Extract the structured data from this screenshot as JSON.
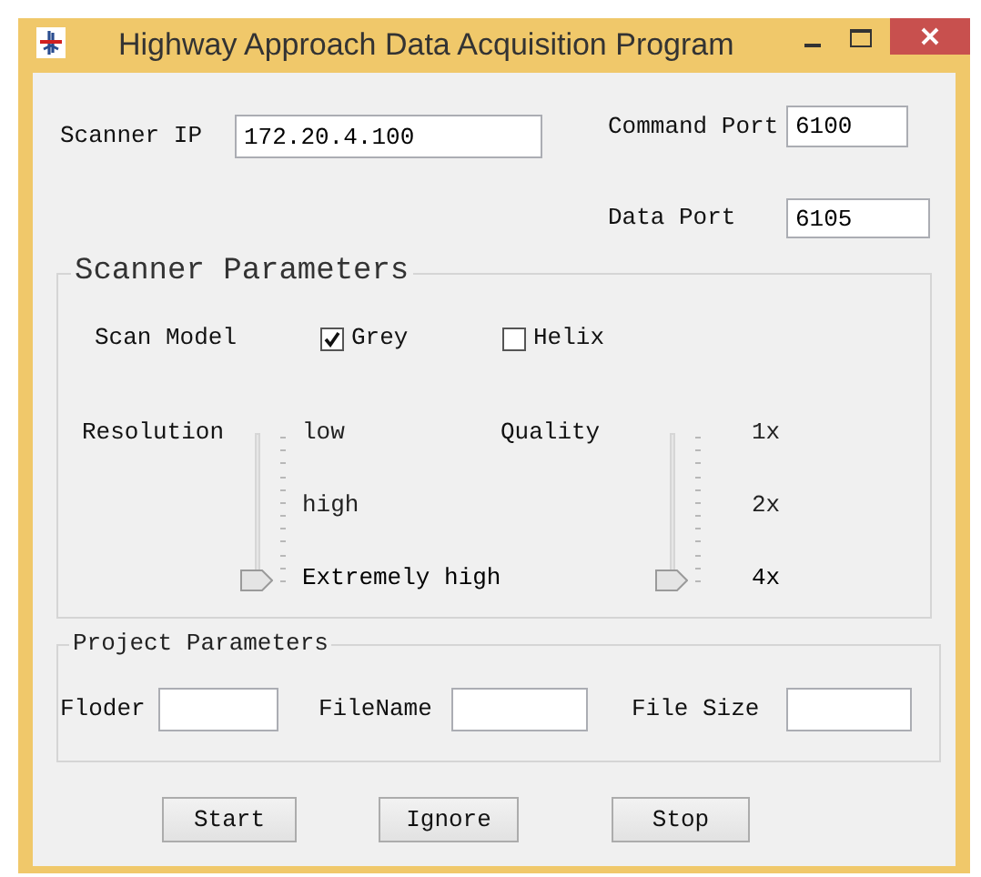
{
  "window": {
    "title": "Highway Approach Data Acquisition Program"
  },
  "connection": {
    "scanner_ip": {
      "label": "Scanner IP",
      "value": "172.20.4.100"
    },
    "command_port": {
      "label": "Command Port",
      "value": "6100"
    },
    "data_port": {
      "label": "Data Port",
      "value": "6105"
    }
  },
  "scanner_parameters": {
    "title": "Scanner Parameters",
    "scan_model": {
      "label": "Scan Model",
      "options": [
        {
          "label": "Grey",
          "checked": true
        },
        {
          "label": "Helix",
          "checked": false
        }
      ]
    },
    "resolution": {
      "label": "Resolution",
      "options": [
        {
          "label": "low",
          "selected": false
        },
        {
          "label": "high",
          "selected": false
        },
        {
          "label": "Extremely high",
          "selected": true
        }
      ]
    },
    "quality": {
      "label": "Quality",
      "options": [
        {
          "label": "1x",
          "selected": false
        },
        {
          "label": "2x",
          "selected": false
        },
        {
          "label": "4x",
          "selected": true
        }
      ]
    }
  },
  "project_parameters": {
    "title": "Project Parameters",
    "fields": [
      {
        "label": "Floder"
      },
      {
        "label": "FileName"
      },
      {
        "label": "File Size"
      }
    ]
  },
  "buttons": [
    "Start",
    "Ignore",
    "Stop"
  ]
}
